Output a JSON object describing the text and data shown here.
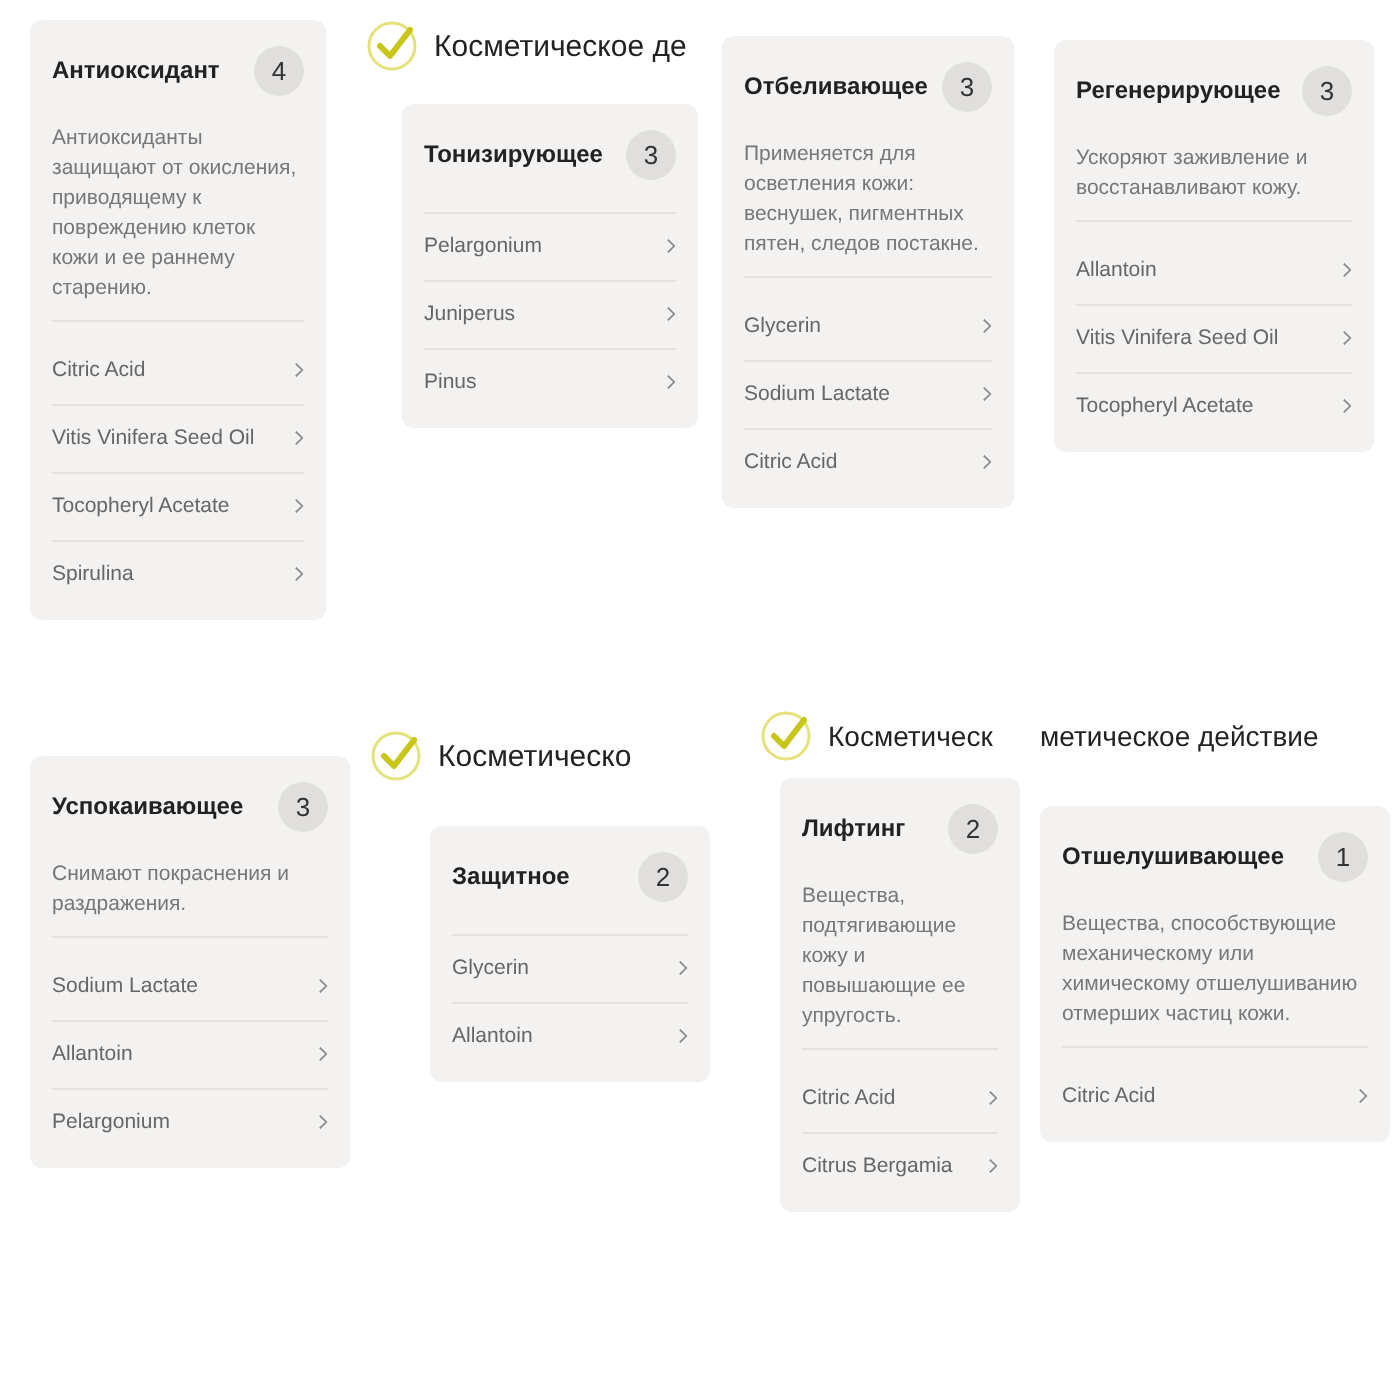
{
  "rows": [
    [
      {
        "card": {
          "title": "Антиоксидант",
          "count": "4",
          "description": "Антиоксиданты защищают от окисления, приводящему к повреждению клеток кожи и ее раннему старению.",
          "items": [
            "Citric Acid",
            "Vitis Vinifera Seed Oil",
            "Tocopheryl Acetate",
            "Spirulina"
          ]
        }
      },
      {
        "header": {
          "text": "Косметическое де",
          "check": true
        },
        "card": {
          "title": "Тонизирующее",
          "count": "3",
          "items": [
            "Pelargonium",
            "Juniperus",
            "Pinus"
          ]
        }
      },
      {
        "card": {
          "title": "Отбеливающее",
          "count": "3",
          "description": "Применяется для осветления кожи: веснушек, пигментных пятен, следов постакне.",
          "items": [
            "Glycerin",
            "Sodium Lactate",
            "Citric Acid"
          ]
        }
      },
      {
        "card": {
          "title": "Регенерирующее",
          "count": "3",
          "description": "Ускоряют заживление и восстанавливают кожу.",
          "items": [
            "Allantoin",
            "Vitis Vinifera Seed Oil",
            "Tocopheryl Acetate"
          ]
        }
      }
    ],
    [
      {
        "card": {
          "title": "Успокаивающее",
          "count": "3",
          "description": "Снимают покраснения и раздражения.",
          "items": [
            "Sodium Lactate",
            "Allantoin",
            "Pelargonium"
          ]
        }
      },
      {
        "header": {
          "text": "Косметическо",
          "check": true
        },
        "card": {
          "title": "Защитное",
          "count": "2",
          "items": [
            "Glycerin",
            "Allantoin"
          ]
        }
      },
      {
        "header": {
          "text": "Косметическ",
          "check": true
        },
        "card": {
          "title": "Лифтинг",
          "count": "2",
          "description": "Вещества, подтягивающие кожу и повышающие ее упругость.",
          "items": [
            "Citric Acid",
            "Citrus Bergamia"
          ]
        }
      },
      {
        "header": {
          "text": "метическое действие",
          "check": false
        },
        "card": {
          "title": "Отшелушивающее",
          "count": "1",
          "description": "Вещества, способствующие механическому или химическому отшелушиванию отмерших частиц кожи.",
          "items": [
            "Citric Acid"
          ]
        }
      }
    ]
  ]
}
